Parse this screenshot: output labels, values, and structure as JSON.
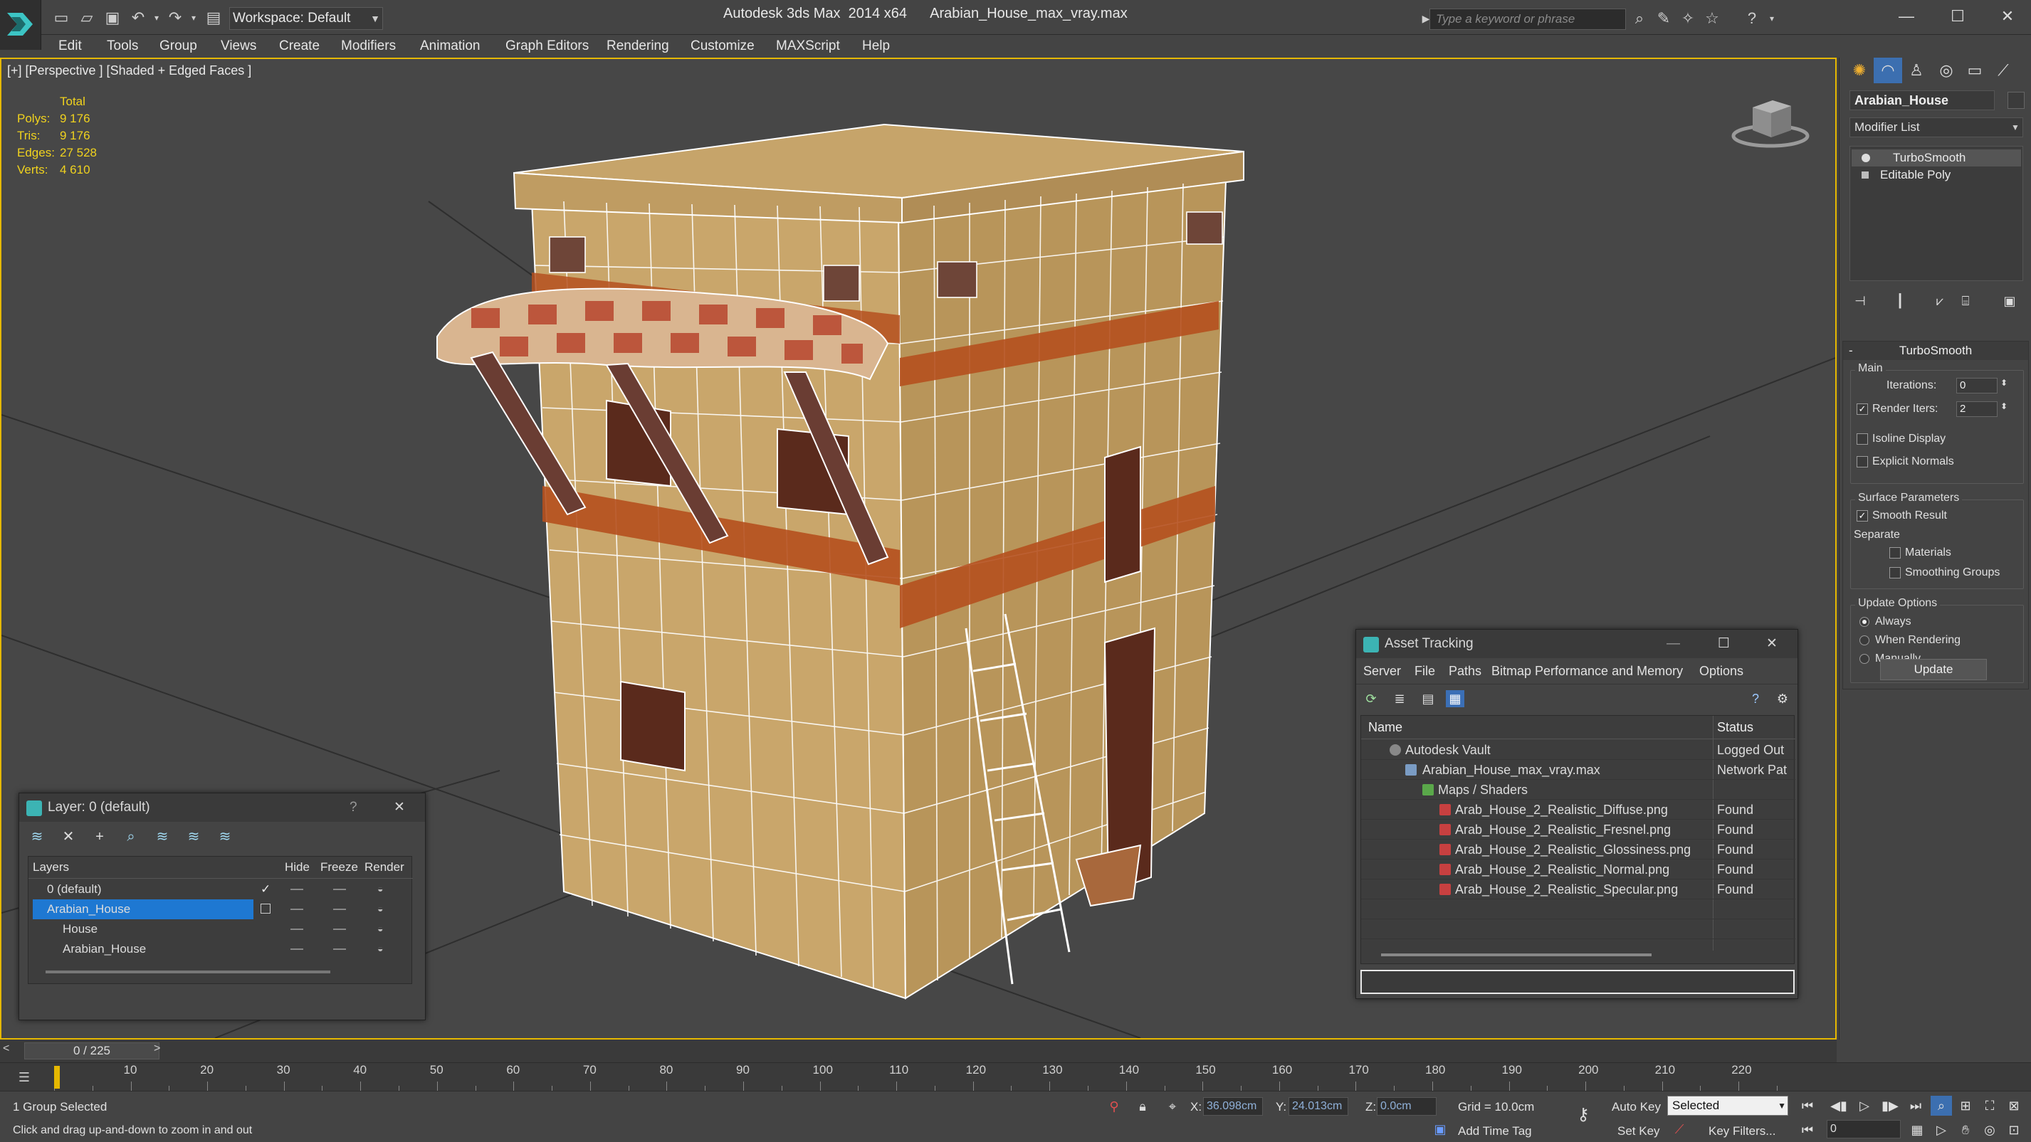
{
  "titlebar": {
    "workspace": "Workspace: Default",
    "app_title": "Autodesk 3ds Max  2014 x64      Arabian_House_max_vray.max",
    "search_placeholder": "Type a keyword or phrase"
  },
  "menu": [
    "Edit",
    "Tools",
    "Group",
    "Views",
    "Create",
    "Modifiers",
    "Animation",
    "Graph Editors",
    "Rendering",
    "Customize",
    "MAXScript",
    "Help"
  ],
  "viewport": {
    "label": "[+] [Perspective ] [Shaded + Edged Faces ]",
    "stats": {
      "header": "Total",
      "rows": [
        {
          "k": "Polys:",
          "v": "9 176"
        },
        {
          "k": "Tris:",
          "v": "9 176"
        },
        {
          "k": "Edges:",
          "v": "27 528"
        },
        {
          "k": "Verts:",
          "v": "4 610"
        }
      ]
    }
  },
  "layer_panel": {
    "title": "Layer: 0 (default)",
    "help": "?",
    "close": "✕",
    "columns": {
      "layers": "Layers",
      "hide": "Hide",
      "freeze": "Freeze",
      "render": "Render"
    },
    "rows": [
      {
        "name": "0 (default)",
        "check": "✓",
        "indent": 0
      },
      {
        "name": "Arabian_House",
        "selected": true,
        "indent": 0
      },
      {
        "name": "House",
        "indent": 1
      },
      {
        "name": "Arabian_House",
        "indent": 1
      }
    ]
  },
  "asset_panel": {
    "title": "Asset Tracking",
    "menu": [
      "Server",
      "File",
      "Paths",
      "Bitmap Performance and Memory",
      "Options"
    ],
    "columns": {
      "name": "Name",
      "status": "Status"
    },
    "rows": [
      {
        "name": "Autodesk Vault",
        "status": "Logged Out",
        "indent": 1
      },
      {
        "name": "Arabian_House_max_vray.max",
        "status": "Network Pat",
        "indent": 2
      },
      {
        "name": "Maps / Shaders",
        "status": "",
        "indent": 3
      },
      {
        "name": "Arab_House_2_Realistic_Diffuse.png",
        "status": "Found",
        "indent": 4
      },
      {
        "name": "Arab_House_2_Realistic_Fresnel.png",
        "status": "Found",
        "indent": 4
      },
      {
        "name": "Arab_House_2_Realistic_Glossiness.png",
        "status": "Found",
        "indent": 4
      },
      {
        "name": "Arab_House_2_Realistic_Normal.png",
        "status": "Found",
        "indent": 4
      },
      {
        "name": "Arab_House_2_Realistic_Specular.png",
        "status": "Found",
        "indent": 4
      }
    ]
  },
  "command_panel": {
    "object_name": "Arabian_House",
    "modifier_list": "Modifier List",
    "stack": [
      "TurboSmooth",
      "Editable Poly"
    ],
    "rollout": {
      "title": "TurboSmooth",
      "main_group": "Main",
      "iterations_label": "Iterations:",
      "iterations_value": "0",
      "render_iters_label": "Render Iters:",
      "render_iters_value": "2",
      "isoline_label": "Isoline Display",
      "explicit_normals_label": "Explicit Normals",
      "surface_group": "Surface Parameters",
      "smooth_result_label": "Smooth Result",
      "separate_label": "Separate",
      "materials_label": "Materials",
      "smoothing_groups_label": "Smoothing Groups",
      "update_group": "Update Options",
      "always_label": "Always",
      "when_rendering_label": "When Rendering",
      "manually_label": "Manually",
      "update_button": "Update"
    }
  },
  "timeline": {
    "frame_display": "0 / 225",
    "left_arrow": "<",
    "right_arrow": ">",
    "ticks": [
      "10",
      "20",
      "30",
      "40",
      "50",
      "60",
      "70",
      "80",
      "90",
      "100",
      "110",
      "120",
      "130",
      "140",
      "150",
      "160",
      "170",
      "180",
      "190",
      "200",
      "210",
      "220"
    ]
  },
  "status": {
    "selection": "1 Group Selected",
    "prompt": "Click and drag up-and-down to zoom in and out",
    "x_label": "X:",
    "x_value": "36.098cm",
    "y_label": "Y:",
    "y_value": "24.013cm",
    "z_label": "Z:",
    "z_value": "0.0cm",
    "grid": "Grid = 10.0cm",
    "add_time_tag": "Add Time Tag",
    "auto_key": "Auto Key",
    "set_key": "Set Key",
    "key_mode": "Selected",
    "key_filters": "Key Filters...",
    "current_frame": "0"
  },
  "colors": {
    "selection_blue": "#1e78d2",
    "stats_yellow": "#f0d21e",
    "viewport_border": "#e6b800"
  }
}
